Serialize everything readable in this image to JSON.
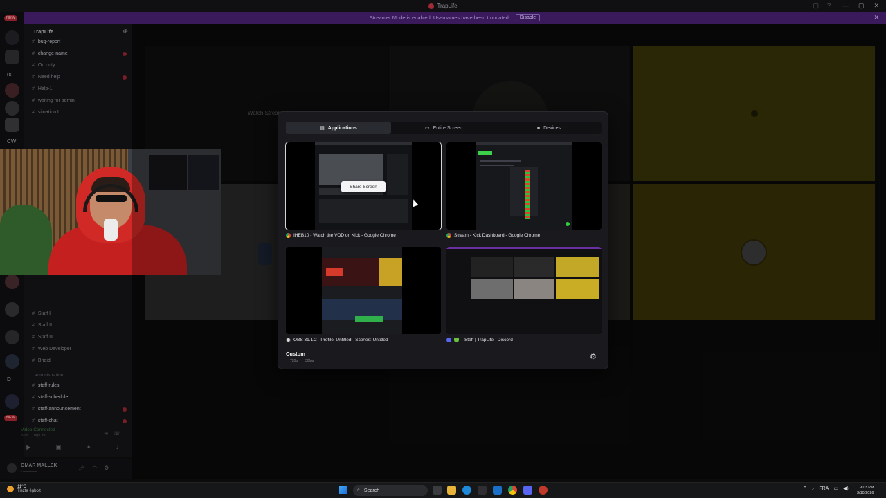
{
  "window": {
    "title": "TrapLife",
    "controls": [
      "—",
      "▢",
      "✕"
    ]
  },
  "banner": {
    "text": "Streamer Mode is enabled. Usernames have been truncated.",
    "disable_label": "Disable"
  },
  "rail": {
    "badges": [
      "NEW",
      "NEW"
    ],
    "labels": [
      "rs",
      "CW",
      "D"
    ]
  },
  "sidebar": {
    "server_name": "TrapLife",
    "channels": [
      {
        "label": "bug-report",
        "bright": true
      },
      {
        "label": "change-name",
        "bright": true
      },
      {
        "label": "On duty",
        "bright": false
      },
      {
        "label": "Need help",
        "bright": false
      },
      {
        "label": "Help-1",
        "bright": false
      },
      {
        "label": "waiting for admin",
        "bright": false
      },
      {
        "label": "situation I",
        "bright": false
      }
    ],
    "staff_channels": [
      {
        "label": "Staff I",
        "bright": false
      },
      {
        "label": "Staff II",
        "bright": false
      },
      {
        "label": "Staff III",
        "bright": false
      },
      {
        "label": "Web Developer",
        "bright": false
      },
      {
        "label": "Bridid",
        "bright": false
      }
    ],
    "category": "administration",
    "admin_channels": [
      {
        "label": "staff-rules",
        "bright": true
      },
      {
        "label": "staff-schedule",
        "bright": true
      },
      {
        "label": "staff-announcement",
        "bright": true
      },
      {
        "label": "staff-chat",
        "bright": true
      }
    ],
    "voice_status": "Video Connected",
    "voice_sub": "Staff / TrapLife",
    "user_name": "OMAR MALLEK",
    "user_tag": "• ⎯⎯⎯⎯⎯⎯⎯⎯"
  },
  "stage": {
    "watch_stream_label": "Watch Stream"
  },
  "modal": {
    "tabs": [
      {
        "label": "Applications",
        "icon": "window-icon",
        "glyph": "▤",
        "active": true
      },
      {
        "label": "Entire Screen",
        "icon": "monitor-icon",
        "glyph": "▭",
        "active": false
      },
      {
        "label": "Devices",
        "icon": "camera-icon",
        "glyph": "■",
        "active": false
      }
    ],
    "apps": [
      {
        "label": "IHEB10 - Watch the VOD on Kick - Google Chrome",
        "icon": "chrome-icon"
      },
      {
        "label": "Stream - Kick Dashboard - Google Chrome",
        "icon": "chrome-icon"
      },
      {
        "label": "OBS 31.1.2 - Profile: Untitled - Scenes: Untitled",
        "icon": "obs-icon"
      },
      {
        "label": "- Staff | TrapLife - Discord",
        "icon": "discord-icon"
      }
    ],
    "share_button_label": "Share Screen",
    "custom_label": "Custom",
    "resolution": "720p",
    "fps": "30fps"
  },
  "taskbar": {
    "weather_temp": "11°C",
    "weather_desc": "Tiszta égbolt",
    "search_label": "Search",
    "language": "FRA",
    "time": "9:03 PM",
    "date": "3/10/2026"
  },
  "colors": {
    "accent_banner": "#3b1a5c",
    "modal_bg": "#1a1a1e",
    "tile_yellow": "#3b3609",
    "badge_red": "#8a2129"
  }
}
